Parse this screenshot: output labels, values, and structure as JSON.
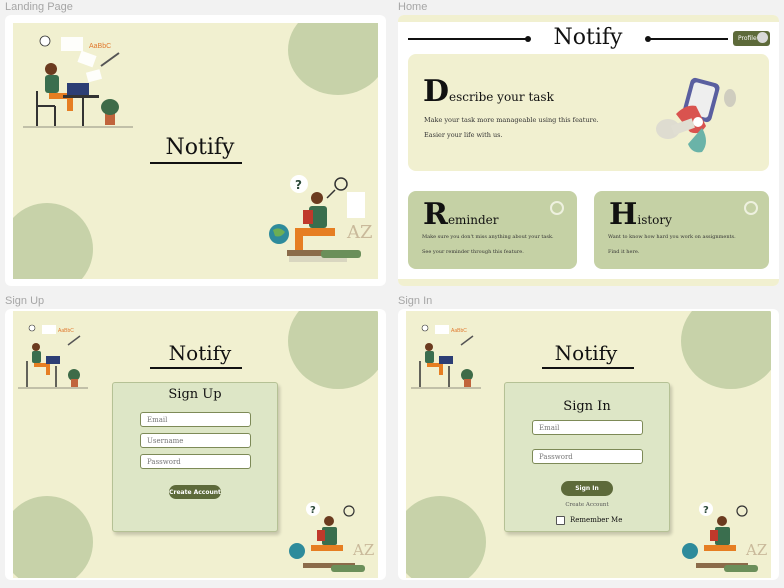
{
  "frames": {
    "landing": {
      "label": "Landing Page",
      "logo": "Notify",
      "illus_text": "AaBbC"
    },
    "home": {
      "label": "Home",
      "logo": "Notify",
      "profile_label": "Profile",
      "describe": {
        "initial": "D",
        "rest": "escribe your task",
        "line1": "Make your task more manageable using this feature.",
        "line2": "Easier your life with us."
      },
      "reminder": {
        "initial": "R",
        "rest": "eminder",
        "line1": "Make sure you don't miss anything about your task.",
        "line2": "See your reminder through this feature."
      },
      "history": {
        "initial": "H",
        "rest": "istory",
        "line1": "Want to know how hard you work on assignments.",
        "line2": "Find it here."
      }
    },
    "signup": {
      "label": "Sign Up",
      "logo": "Notify",
      "title": "Sign Up",
      "email_placeholder": "Email",
      "username_placeholder": "Username",
      "password_placeholder": "Password",
      "button": "Create Account",
      "illus_text": "AaBbC"
    },
    "signin": {
      "label": "Sign In",
      "logo": "Notify",
      "title": "Sign In",
      "email_placeholder": "Email",
      "password_placeholder": "Password",
      "button": "Sign In",
      "create_link": "Create Account",
      "remember": "Remember Me",
      "illus_text": "AaBbC"
    }
  },
  "colors": {
    "board": "#f1f0d0",
    "accent": "#5d6a3a",
    "circle": "#c7d2a9",
    "panel": "#dde6c6"
  },
  "icons": [
    "reading-person-illustration",
    "laptop-person-illustration",
    "profile-toggle",
    "ring-icon",
    "hand-phone-illustration"
  ]
}
